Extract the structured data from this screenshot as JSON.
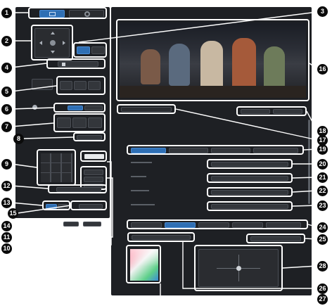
{
  "callouts": {
    "c1": "1",
    "c2": "2",
    "c3": "3",
    "c4": "4",
    "c5": "5",
    "c6": "6",
    "c7": "7",
    "c8": "8",
    "c9": "9",
    "c10": "10",
    "c11": "11",
    "c12": "12",
    "c13": "13",
    "c14": "14",
    "c15": "15",
    "c16": "16",
    "c17": "17",
    "c18": "18",
    "c19": "19",
    "c20": "20",
    "c21": "21",
    "c22": "22",
    "c23": "23",
    "c24": "24",
    "c25": "25",
    "c26": "26",
    "c27": "27",
    "c28": "28"
  },
  "colors": {
    "panel": "#1e2024",
    "control": "#33363b",
    "accent_blue": "#2f6fb4",
    "callout": "#0b0b0b",
    "outline": "#ffffff"
  },
  "icons": [
    "tile-view-icon",
    "settings-icon",
    "pan-tilt-arrow-icons",
    "home-icon",
    "zoom-icon",
    "focus-icon"
  ]
}
